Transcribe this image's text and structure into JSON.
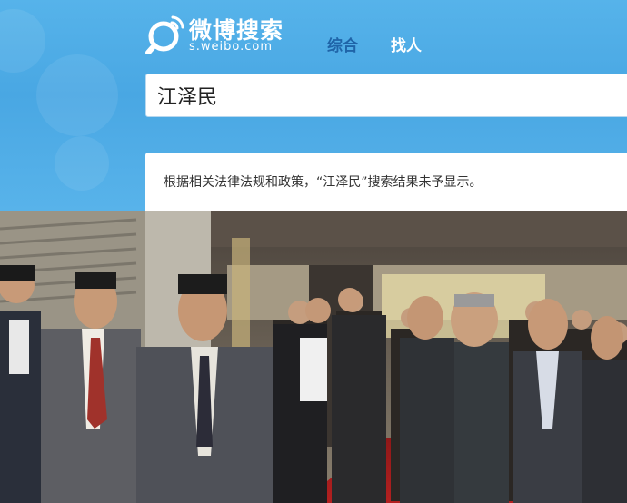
{
  "header": {
    "logo_text": "微博搜索",
    "logo_url": "s.weibo.com",
    "tabs": [
      {
        "label": "综合",
        "active": true
      },
      {
        "label": "找人",
        "active": false
      }
    ]
  },
  "search": {
    "value": "江泽民"
  },
  "notice": {
    "text": "根据相关法律法规和政策，“江泽民”搜索结果未予显示。"
  },
  "colors": {
    "background_blue": "#4aa4e0",
    "active_tab": "#1f64a8",
    "notice_bg": "#ffffff",
    "carpet_red": "#a41c1c"
  },
  "icons": [
    "weibo-logo-icon"
  ],
  "photo": {
    "description": "group-photo"
  }
}
